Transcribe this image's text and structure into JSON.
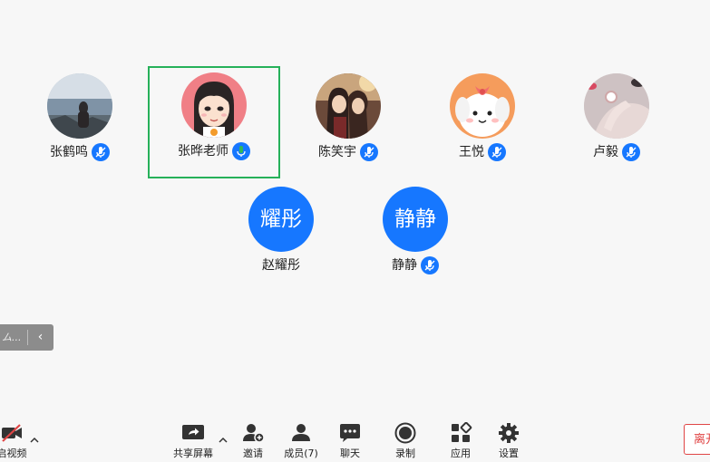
{
  "participants": [
    {
      "name": "张鹤鸣",
      "avatar_type": "photo",
      "avatar_desc": "seaside-photo",
      "mic": "muted-listening",
      "active": false
    },
    {
      "name": "张晔老师",
      "avatar_type": "photo",
      "avatar_desc": "cartoon-girl",
      "mic": "speaking",
      "active": true
    },
    {
      "name": "陈笑宇",
      "avatar_type": "photo",
      "avatar_desc": "anime-photo",
      "mic": "muted-listening",
      "active": false
    },
    {
      "name": "王悦",
      "avatar_type": "photo",
      "avatar_desc": "cartoon-dog",
      "mic": "muted-listening",
      "active": false
    },
    {
      "name": "卢毅",
      "avatar_type": "photo",
      "avatar_desc": "hand-photo",
      "mic": "muted-listening",
      "active": false
    },
    {
      "name": "赵耀彤",
      "avatar_type": "text",
      "avatar_text": "耀彤",
      "mic": "none",
      "active": false
    },
    {
      "name": "静静",
      "avatar_type": "text",
      "avatar_text": "静静",
      "mic": "muted-listening",
      "active": false
    }
  ],
  "float_handle": {
    "text": "ム...",
    "collapse_icon": "chevron-left-icon"
  },
  "toolbar": {
    "video": {
      "label": "启视频",
      "icon": "video-off-icon"
    },
    "share": {
      "label": "共享屏幕",
      "icon": "share-screen-icon"
    },
    "invite": {
      "label": "邀请",
      "icon": "add-user-icon"
    },
    "members": {
      "label": "成员(7)",
      "icon": "members-icon"
    },
    "chat": {
      "label": "聊天",
      "icon": "chat-icon"
    },
    "record": {
      "label": "录制",
      "icon": "record-icon"
    },
    "apps": {
      "label": "应用",
      "icon": "apps-icon"
    },
    "settings": {
      "label": "设置",
      "icon": "gear-icon"
    },
    "leave": {
      "label": "离开"
    }
  },
  "colors": {
    "accent": "#1677ff",
    "active_border": "#26b15a",
    "speaking": "#2fb85a",
    "leave": "#e04545"
  }
}
